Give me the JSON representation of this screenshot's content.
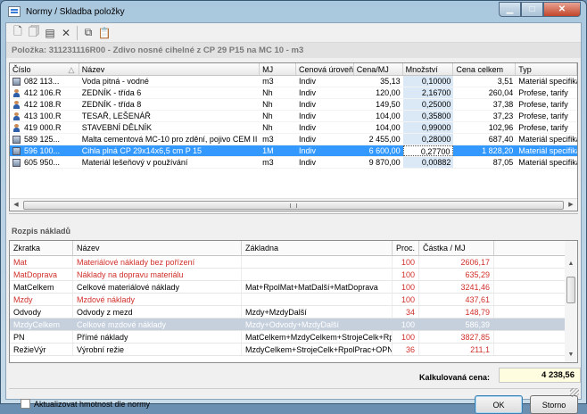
{
  "window": {
    "title": "Normy / Skladba položky"
  },
  "toolbar": {
    "icons": [
      "new-doc-icon",
      "copy-doc-icon",
      "properties-icon",
      "delete-icon",
      "copy-icon",
      "paste-icon"
    ]
  },
  "item": {
    "label": "Položka:",
    "code": "311231116R00",
    "separator": " - ",
    "name": "Zdivo nosné cihelné z CP 29 P15 na MC 10",
    "unit": "m3"
  },
  "grid1": {
    "columns": {
      "cislo": "Číslo",
      "nazev": "Název",
      "mj": "MJ",
      "uroven": "Cenová úroveň",
      "cena": "Cena/MJ",
      "mnozstvi": "Množství",
      "celkem": "Cena celkem",
      "typ": "Typ"
    },
    "rows": [
      {
        "cislo": "082 113...",
        "nazev": "Voda pitná - vodné",
        "mj": "m3",
        "uroven": "Indiv",
        "cena": "35,13",
        "mnozstvi": "0,10000",
        "celkem": "3,51",
        "typ": "Materiál specifikace",
        "icon": "material-icon"
      },
      {
        "cislo": "412 106.R",
        "nazev": "ZEDNÍK - třída 6",
        "mj": "Nh",
        "uroven": "Indiv",
        "cena": "120,00",
        "mnozstvi": "2,16700",
        "celkem": "260,04",
        "typ": "Profese, tarify",
        "icon": "worker-icon"
      },
      {
        "cislo": "412 108.R",
        "nazev": "ZEDNÍK - třída 8",
        "mj": "Nh",
        "uroven": "Indiv",
        "cena": "149,50",
        "mnozstvi": "0,25000",
        "celkem": "37,38",
        "typ": "Profese, tarify",
        "icon": "worker-icon"
      },
      {
        "cislo": "413 100.R",
        "nazev": "TESAŘ, LEŠENÁŘ",
        "mj": "Nh",
        "uroven": "Indiv",
        "cena": "104,00",
        "mnozstvi": "0,35800",
        "celkem": "37,23",
        "typ": "Profese, tarify",
        "icon": "worker-icon"
      },
      {
        "cislo": "419 000.R",
        "nazev": "STAVEBNÍ DĚLNÍK",
        "mj": "Nh",
        "uroven": "Indiv",
        "cena": "104,00",
        "mnozstvi": "0,99000",
        "celkem": "102,96",
        "typ": "Profese, tarify",
        "icon": "worker-icon"
      },
      {
        "cislo": "589 125...",
        "nazev": "Malta cementová MC-10 pro zdění, pojivo CEM II",
        "mj": "m3",
        "uroven": "Indiv",
        "cena": "2 455,00",
        "mnozstvi": "0,28000",
        "celkem": "687,40",
        "typ": "Materiál specifikace",
        "icon": "material-icon"
      },
      {
        "cislo": "596 100...",
        "nazev": "Cihla plná CP 29x14x6,5 cm P 15",
        "mj": "1M",
        "uroven": "Indiv",
        "cena": "6 600,00",
        "mnozstvi": "0,27700",
        "celkem": "1 828,20",
        "typ": "Materiál specifikace",
        "icon": "material-icon",
        "selected": true
      },
      {
        "cislo": "605 950...",
        "nazev": "Materiál lešeňový v používání",
        "mj": "m3",
        "uroven": "Indiv",
        "cena": "9 870,00",
        "mnozstvi": "0,00882",
        "celkem": "87,05",
        "typ": "Materiál specifikace",
        "icon": "material-icon"
      }
    ]
  },
  "breakdown": {
    "title": "Rozpis nákladů",
    "columns": {
      "zkratka": "Zkratka",
      "nazev": "Název",
      "zakladna": "Základna",
      "proc": "Proc.",
      "castka": "Částka / MJ"
    },
    "rows": [
      {
        "zkratka": "Mat",
        "nazev": "Materiálové náklady bez pořízení",
        "zakladna": "",
        "proc": "100",
        "castka": "2606,17",
        "style": "red"
      },
      {
        "zkratka": "MatDoprava",
        "nazev": "Náklady na dopravu materiálu",
        "zakladna": "",
        "proc": "100",
        "castka": "635,29",
        "style": "red"
      },
      {
        "zkratka": "MatCelkem",
        "nazev": "Celkové materiálové náklady",
        "zakladna": "Mat+RpolMat+MatDalší+MatDoprava",
        "proc": "100",
        "castka": "3241,46",
        "style": ""
      },
      {
        "zkratka": "Mzdy",
        "nazev": "Mzdové náklady",
        "zakladna": "",
        "proc": "100",
        "castka": "437,61",
        "style": "red"
      },
      {
        "zkratka": "Odvody",
        "nazev": "Odvody z mezd",
        "zakladna": "Mzdy+MzdyDalší",
        "proc": "34",
        "castka": "148,79",
        "style": ""
      },
      {
        "zkratka": "MzdyCelkem",
        "nazev": "Celkové mzdové náklady",
        "zakladna": "Mzdy+Odvody+MzdyDalší",
        "proc": "100",
        "castka": "586,39",
        "style": "sel"
      },
      {
        "zkratka": "PN",
        "nazev": "Přímé náklady",
        "zakladna": "MatCelkem+MzdyCelkem+StrojeCelk+Rpo...",
        "proc": "100",
        "castka": "3827,85",
        "style": ""
      },
      {
        "zkratka": "RežieVýr",
        "nazev": "Výrobní režie",
        "zakladna": "MzdyCelkem+StrojeCelk+RpolPrac+OPN...",
        "proc": "36",
        "castka": "211,1",
        "style": ""
      }
    ]
  },
  "footer": {
    "price_label": "Kalkulovaná cena:",
    "price_value": "4 238,56",
    "checkbox_label": "Aktualizovat hmotnost dle normy",
    "ok_label": "OK",
    "cancel_label": "Storno"
  }
}
